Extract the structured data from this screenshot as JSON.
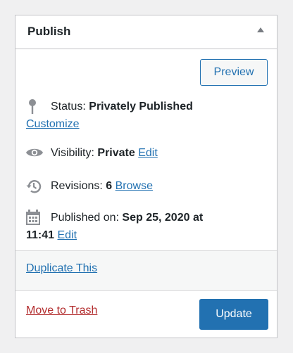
{
  "box": {
    "title": "Publish",
    "toggle_icon": "triangle-up-icon"
  },
  "actions": {
    "preview_label": "Preview",
    "update_label": "Update",
    "trash_label": "Move to Trash",
    "duplicate_label": "Duplicate This"
  },
  "status": {
    "icon": "pin-icon",
    "label": "Status:",
    "value": "Privately Published",
    "link": "Customize"
  },
  "visibility": {
    "icon": "eye-icon",
    "label": "Visibility:",
    "value": "Private",
    "link": "Edit"
  },
  "revisions": {
    "icon": "history-icon",
    "label": "Revisions:",
    "value": "6",
    "link": "Browse"
  },
  "published": {
    "icon": "calendar-icon",
    "label": "Published on:",
    "value_line1": "Sep 25, 2020 at",
    "value_line2": "11:41",
    "link": "Edit"
  },
  "colors": {
    "accent": "#2271b1",
    "danger": "#b32d2e",
    "icon": "#8c8f94",
    "border": "#c3c4c7"
  }
}
